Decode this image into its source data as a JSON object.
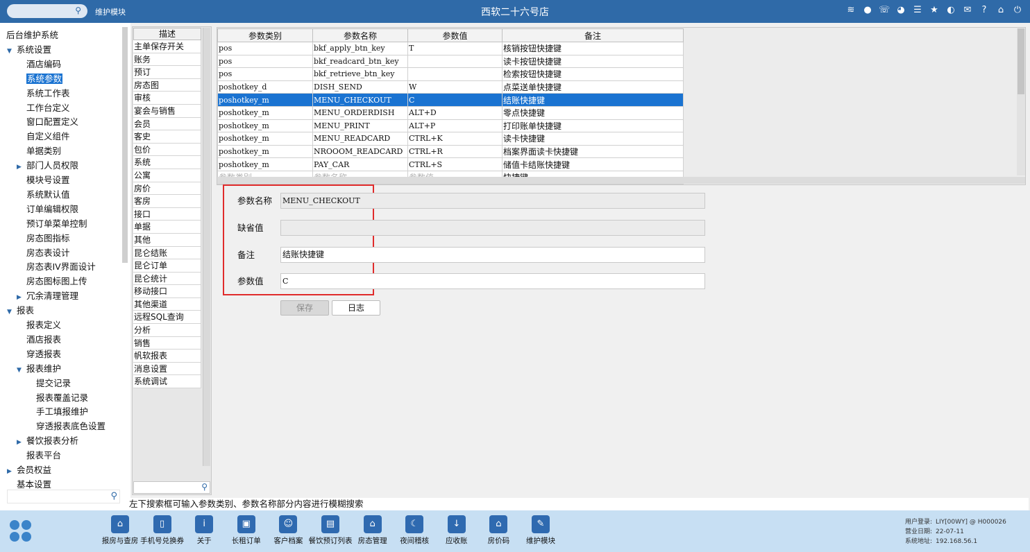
{
  "topbar": {
    "module": "维护模块",
    "title": "西软二十六号店",
    "icons": [
      "wifi-icon",
      "chat-icon",
      "phone-icon",
      "palette-icon",
      "menu-icon",
      "star-icon",
      "moon-icon",
      "mail-icon",
      "help-icon",
      "home-icon",
      "power-icon"
    ]
  },
  "sidebar": {
    "items": [
      {
        "label": "后台维护系统",
        "level": 0,
        "arrow": ""
      },
      {
        "label": "系统设置",
        "level": 1,
        "arrow": "▼"
      },
      {
        "label": "酒店编码",
        "level": 2,
        "arrow": ""
      },
      {
        "label": "系统参数",
        "level": 2,
        "arrow": "",
        "selected": true
      },
      {
        "label": "系统工作表",
        "level": 2,
        "arrow": ""
      },
      {
        "label": "工作台定义",
        "level": 2,
        "arrow": ""
      },
      {
        "label": "窗口配置定义",
        "level": 2,
        "arrow": ""
      },
      {
        "label": "自定义组件",
        "level": 2,
        "arrow": ""
      },
      {
        "label": "单据类别",
        "level": 2,
        "arrow": ""
      },
      {
        "label": "部门人员权限",
        "level": 2,
        "arrow": "▶"
      },
      {
        "label": "模块号设置",
        "level": 2,
        "arrow": ""
      },
      {
        "label": "系统默认值",
        "level": 2,
        "arrow": ""
      },
      {
        "label": "订单编辑权限",
        "level": 2,
        "arrow": ""
      },
      {
        "label": "预订单菜单控制",
        "level": 2,
        "arrow": ""
      },
      {
        "label": "房态图指标",
        "level": 2,
        "arrow": ""
      },
      {
        "label": "房态表设计",
        "level": 2,
        "arrow": ""
      },
      {
        "label": "房态表IV界面设计",
        "level": 2,
        "arrow": ""
      },
      {
        "label": "房态图标图上传",
        "level": 2,
        "arrow": ""
      },
      {
        "label": "冗余清理管理",
        "level": 2,
        "arrow": "▶"
      },
      {
        "label": "报表",
        "level": 1,
        "arrow": "▼"
      },
      {
        "label": "报表定义",
        "level": 2,
        "arrow": ""
      },
      {
        "label": "酒店报表",
        "level": 2,
        "arrow": ""
      },
      {
        "label": "穿透报表",
        "level": 2,
        "arrow": ""
      },
      {
        "label": "报表维护",
        "level": 2,
        "arrow": "▼"
      },
      {
        "label": "提交记录",
        "level": 3,
        "arrow": ""
      },
      {
        "label": "报表覆盖记录",
        "level": 3,
        "arrow": ""
      },
      {
        "label": "手工填报维护",
        "level": 3,
        "arrow": ""
      },
      {
        "label": "穿透报表底色设置",
        "level": 3,
        "arrow": ""
      },
      {
        "label": "餐饮报表分析",
        "level": 2,
        "arrow": "▶"
      },
      {
        "label": "报表平台",
        "level": 2,
        "arrow": ""
      },
      {
        "label": "会员权益",
        "level": 1,
        "arrow": "▶"
      },
      {
        "label": "基本设置",
        "level": 1,
        "arrow": ""
      }
    ]
  },
  "desc_panel": {
    "header": "描述",
    "items": [
      "主单保存开关",
      "账务",
      "预订",
      "房态图",
      "审核",
      "宴会与销售",
      "会员",
      "客史",
      "包价",
      "系统",
      "公寓",
      "房价",
      "客房",
      "接口",
      "单据",
      "其他",
      "昆仑结账",
      "昆仑订单",
      "昆仑统计",
      "移动接口",
      "其他渠道",
      "远程SQL查询",
      "分析",
      "销售",
      "帆软报表",
      "消息设置",
      "系统调试"
    ]
  },
  "table": {
    "columns": [
      "参数类别",
      "参数名称",
      "参数值",
      "备注"
    ],
    "rows": [
      {
        "cat": "pos",
        "name": "bkf_apply_btn_key",
        "value": "T",
        "note": "核销按钮快捷键"
      },
      {
        "cat": "pos",
        "name": "bkf_readcard_btn_key",
        "value": "",
        "note": "读卡按钮快捷键"
      },
      {
        "cat": "pos",
        "name": "bkf_retrieve_btn_key",
        "value": "",
        "note": "检索按钮快捷键"
      },
      {
        "cat": "poshotkey_d",
        "name": "DISH_SEND",
        "value": "W",
        "note": "点菜送单快捷键"
      },
      {
        "cat": "poshotkey_m",
        "name": "MENU_CHECKOUT",
        "value": "C",
        "note": "结账快捷键",
        "selected": true
      },
      {
        "cat": "poshotkey_m",
        "name": "MENU_ORDERDISH",
        "value": "ALT+D",
        "note": "零点快捷键"
      },
      {
        "cat": "poshotkey_m",
        "name": "MENU_PRINT",
        "value": "ALT+P",
        "note": "打印账单快捷键"
      },
      {
        "cat": "poshotkey_m",
        "name": "MENU_READCARD",
        "value": "CTRL+K",
        "note": "读卡快捷键"
      },
      {
        "cat": "poshotkey_m",
        "name": "NROOOM_READCARD",
        "value": "CTRL+R",
        "note": "档案界面读卡快捷键"
      },
      {
        "cat": "poshotkey_m",
        "name": "PAY_CAR",
        "value": "CTRL+S",
        "note": "储值卡结账快捷键"
      }
    ],
    "filter": {
      "cat_placeholder": "参数类别",
      "name_placeholder": "参数名称",
      "value_placeholder": "参数值",
      "note_value": "快捷键"
    }
  },
  "form": {
    "name_label": "参数名称",
    "name_value": "MENU_CHECKOUT",
    "default_label": "缺省值",
    "default_value": "",
    "note_label": "备注",
    "note_value": "结账快捷键",
    "value_label": "参数值",
    "value_value": "C",
    "save_label": "保存",
    "log_label": "日志"
  },
  "hint": "左下搜索框可输入参数类别、参数名称部分内容进行模糊搜索",
  "taskbar": {
    "buttons": [
      {
        "label": "报房与查房",
        "icon": "house-search-icon",
        "glyph": "⌂"
      },
      {
        "label": "手机号兑换券",
        "icon": "phone-coupon-icon",
        "glyph": "▯"
      },
      {
        "label": "关于",
        "icon": "info-icon",
        "glyph": "i"
      },
      {
        "label": "长租订单",
        "icon": "luggage-icon",
        "glyph": "▣"
      },
      {
        "label": "客户档案",
        "icon": "profile-icon",
        "glyph": "☺"
      },
      {
        "label": "餐饮预订列表",
        "icon": "clipboard-icon",
        "glyph": "▤"
      },
      {
        "label": "房态管理",
        "icon": "home-icon",
        "glyph": "⌂"
      },
      {
        "label": "夜间稽核",
        "icon": "moon-icon",
        "glyph": "☾"
      },
      {
        "label": "应收账",
        "icon": "download-icon",
        "glyph": "↓"
      },
      {
        "label": "房价码",
        "icon": "building-icon",
        "glyph": "⌂"
      },
      {
        "label": "维护模块",
        "icon": "wrench-icon",
        "glyph": "✎"
      }
    ],
    "sysinfo": {
      "user_key": "用户登录:",
      "user_value": "LIY[00WY] @ H000026",
      "date_key": "营业日期:",
      "date_value": "22-07-11",
      "addr_key": "系统地址:",
      "addr_value": "192.168.56.1"
    }
  }
}
